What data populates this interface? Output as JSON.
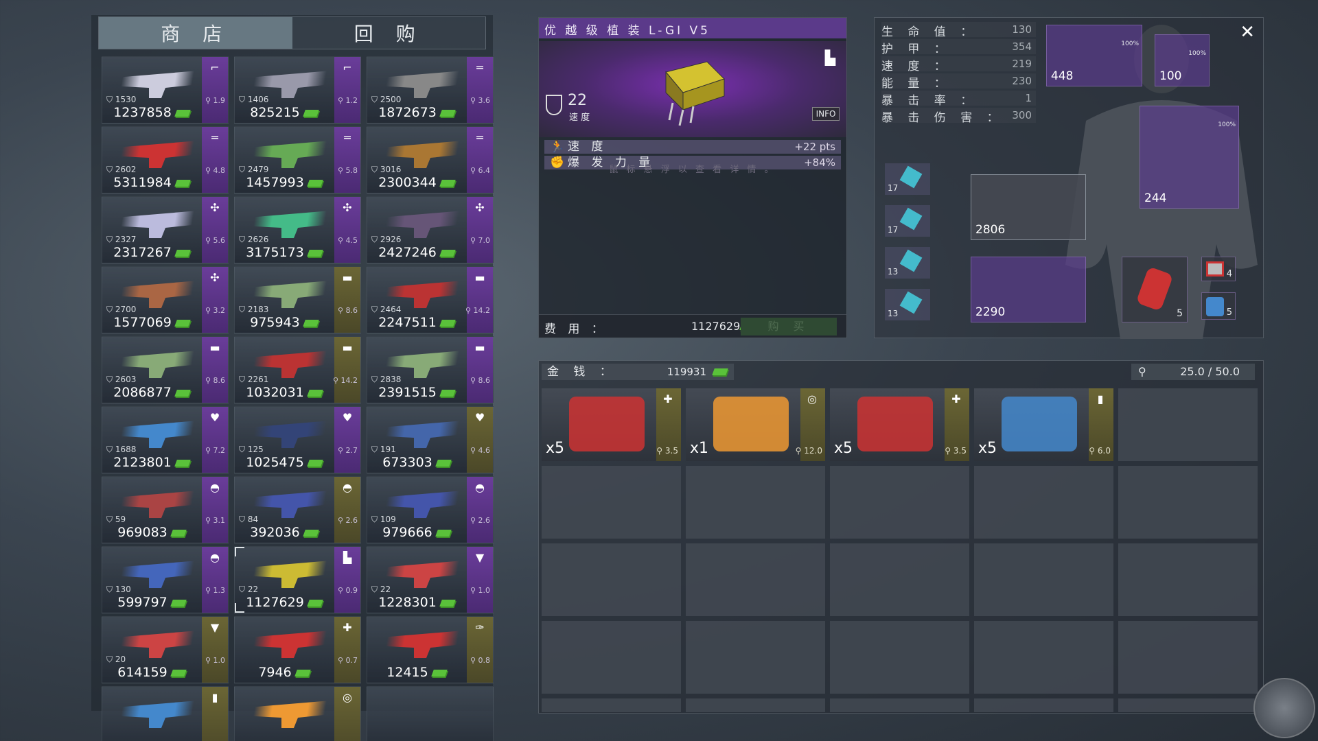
{
  "shop": {
    "tabs": [
      "商 店",
      "回 购"
    ],
    "items": [
      {
        "armor": "1530",
        "weight": "1.9",
        "price": "1237858",
        "color": "p",
        "icon": "pistol-icon",
        "art": "#ccd"
      },
      {
        "armor": "1406",
        "weight": "1.2",
        "price": "825215",
        "color": "p",
        "icon": "pistol-icon",
        "art": "#99a"
      },
      {
        "armor": "2500",
        "weight": "3.6",
        "price": "1872673",
        "color": "p",
        "icon": "rifle-icon",
        "art": "#888"
      },
      {
        "armor": "2602",
        "weight": "4.8",
        "price": "5311984",
        "color": "p",
        "icon": "shotgun-icon",
        "art": "#c33"
      },
      {
        "armor": "2479",
        "weight": "5.8",
        "price": "1457993",
        "color": "p",
        "icon": "shotgun-icon",
        "art": "#6a5"
      },
      {
        "armor": "3016",
        "weight": "6.4",
        "price": "2300344",
        "color": "p",
        "icon": "shotgun-icon",
        "art": "#a73"
      },
      {
        "armor": "2327",
        "weight": "5.6",
        "price": "2317267",
        "color": "p",
        "icon": "heavy-gun-icon",
        "art": "#bbd"
      },
      {
        "armor": "2626",
        "weight": "4.5",
        "price": "3175173",
        "color": "p",
        "icon": "heavy-gun-icon",
        "art": "#4b8"
      },
      {
        "armor": "2926",
        "weight": "7.0",
        "price": "2427246",
        "color": "p",
        "icon": "heavy-gun-icon",
        "art": "#657"
      },
      {
        "armor": "2700",
        "weight": "3.2",
        "price": "1577069",
        "color": "p",
        "icon": "heavy-gun-icon",
        "art": "#a64"
      },
      {
        "armor": "2183",
        "weight": "8.6",
        "price": "975943",
        "color": "g",
        "icon": "launcher-icon",
        "art": "#8a7"
      },
      {
        "armor": "2464",
        "weight": "14.2",
        "price": "2247511",
        "color": "p",
        "icon": "launcher-icon",
        "art": "#b33"
      },
      {
        "armor": "2603",
        "weight": "8.6",
        "price": "2086877",
        "color": "p",
        "icon": "launcher-icon",
        "art": "#8a7"
      },
      {
        "armor": "2261",
        "weight": "14.2",
        "price": "1032031",
        "color": "g",
        "icon": "launcher-icon",
        "art": "#b33"
      },
      {
        "armor": "2838",
        "weight": "8.6",
        "price": "2391515",
        "color": "p",
        "icon": "launcher-icon",
        "art": "#8a7"
      },
      {
        "armor": "1688",
        "weight": "7.2",
        "price": "2123801",
        "color": "p",
        "icon": "body-armor-icon",
        "art": "#48c"
      },
      {
        "armor": "125",
        "weight": "2.7",
        "price": "1025475",
        "color": "p",
        "icon": "body-armor-icon",
        "art": "#347"
      },
      {
        "armor": "191",
        "weight": "4.6",
        "price": "673303",
        "color": "g",
        "icon": "body-armor-icon",
        "art": "#46a"
      },
      {
        "armor": "59",
        "weight": "3.1",
        "price": "969083",
        "color": "p",
        "icon": "helmet-icon",
        "art": "#a44"
      },
      {
        "armor": "84",
        "weight": "2.6",
        "price": "392036",
        "color": "g",
        "icon": "helmet-icon",
        "art": "#45a"
      },
      {
        "armor": "109",
        "weight": "2.6",
        "price": "979666",
        "color": "p",
        "icon": "helmet-icon",
        "art": "#45a"
      },
      {
        "armor": "130",
        "weight": "1.3",
        "price": "599797",
        "color": "p",
        "icon": "helmet-icon",
        "art": "#46b"
      },
      {
        "armor": "22",
        "weight": "0.9",
        "price": "1127629",
        "color": "p",
        "icon": "boot-icon",
        "art": "#cb3",
        "selected": true
      },
      {
        "armor": "22",
        "weight": "1.0",
        "price": "1228301",
        "color": "p",
        "icon": "shirt-icon",
        "art": "#c44"
      },
      {
        "armor": "20",
        "weight": "1.0",
        "price": "614159",
        "color": "g",
        "icon": "shirt-icon",
        "art": "#c44"
      },
      {
        "armor": "",
        "weight": "0.7",
        "price": "7946",
        "color": "g",
        "icon": "medkit-icon",
        "art": "#c33"
      },
      {
        "armor": "",
        "weight": "0.8",
        "price": "12415",
        "color": "g",
        "icon": "grenade-icon",
        "art": "#c33"
      },
      {
        "armor": "",
        "weight": "",
        "price": "",
        "color": "g",
        "icon": "battery-icon",
        "art": "#48c"
      },
      {
        "armor": "",
        "weight": "",
        "price": "",
        "color": "g",
        "icon": "device-icon",
        "art": "#e93"
      },
      {
        "armor": "",
        "weight": "",
        "price": "",
        "color": "",
        "icon": "",
        "art": ""
      }
    ]
  },
  "detail": {
    "title": "优 越 级 植 装 L-GI V5",
    "value": "22",
    "value_label": "速 度",
    "info": "INFO",
    "stats": [
      {
        "label": "速 度",
        "value": "+22 pts"
      },
      {
        "label": "爆 发 力 量",
        "value": "+84%"
      }
    ],
    "hint": "鼠 标 悬 浮 以 查 看 详 情 。",
    "cost_label": "费 用 ：",
    "cost_value": "1127629",
    "buy": "购 买"
  },
  "character": {
    "stats": [
      {
        "label": "生 命 值 ：",
        "value": "130"
      },
      {
        "label": "护 甲 ：",
        "value": "354"
      },
      {
        "label": "速 度 ：",
        "value": "219"
      },
      {
        "label": "能 量 ：",
        "value": "230"
      },
      {
        "label": "暴 击 率 ：",
        "value": "1"
      },
      {
        "label": "暴 击 伤 害 ：",
        "value": "300"
      }
    ],
    "slots": {
      "gun_top": "448",
      "head": "100",
      "body": "244",
      "primary": "2806",
      "secondary": "2290",
      "grenade_qty": "5",
      "medkit_qty": "4",
      "battery_qty": "5"
    },
    "small": [
      "17",
      "17",
      "13",
      "13"
    ],
    "pct": "100%"
  },
  "inventory": {
    "money_label": "金 钱 ：",
    "money": "119931",
    "weight": "25.0 / 50.0",
    "items": [
      {
        "qty": "x5",
        "weight": "3.5",
        "icon": "medkit-icon",
        "art": "#c33"
      },
      {
        "qty": "x1",
        "weight": "12.0",
        "icon": "device-icon",
        "art": "#e93"
      },
      {
        "qty": "x5",
        "weight": "3.5",
        "icon": "medkit-icon",
        "art": "#c33"
      },
      {
        "qty": "x5",
        "weight": "6.0",
        "icon": "battery-icon",
        "art": "#48c"
      }
    ]
  },
  "colors": {
    "purple": "#6a3d9a",
    "olive": "#6b6635",
    "cash": "#5ac23a"
  }
}
